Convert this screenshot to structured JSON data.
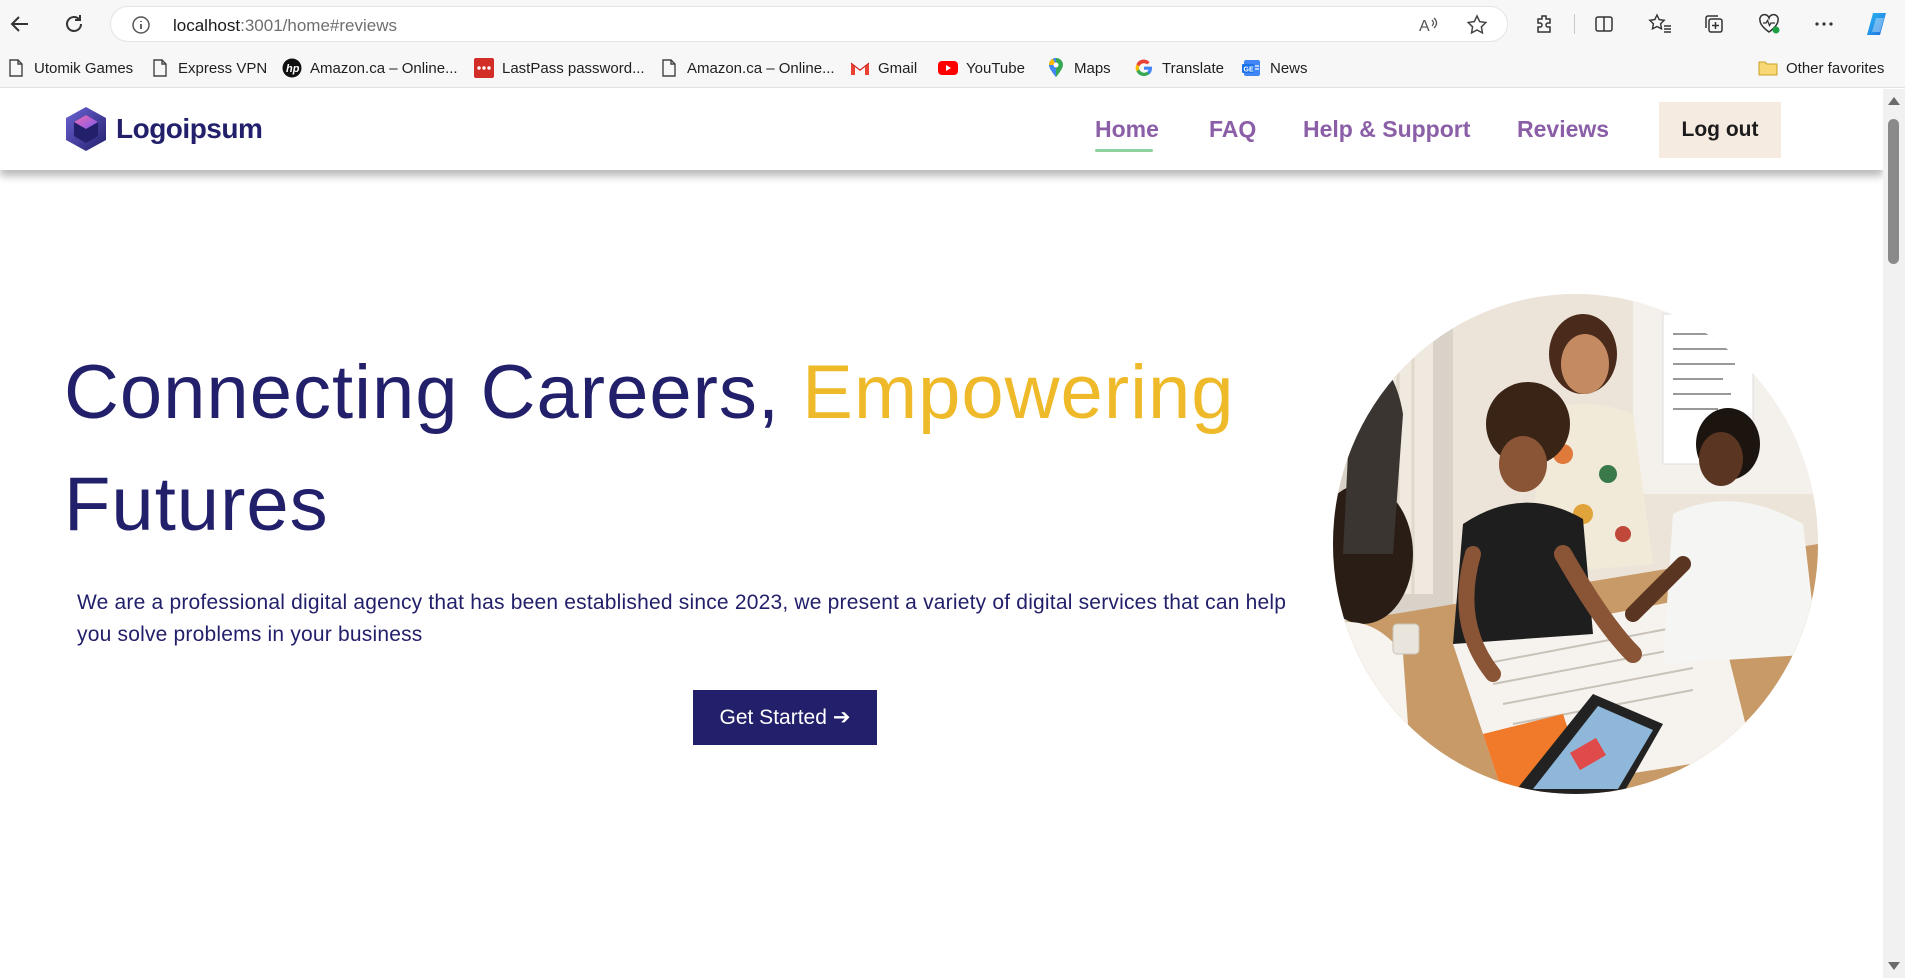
{
  "browser": {
    "url_host": "localhost",
    "url_path": ":3001/home#reviews",
    "bookmarks": [
      {
        "label": "Utomik Games",
        "icon": "page-icon"
      },
      {
        "label": "Express VPN",
        "icon": "page-icon"
      },
      {
        "label": "Amazon.ca – Online...",
        "icon": "hp-icon"
      },
      {
        "label": "LastPass password...",
        "icon": "lastpass-icon"
      },
      {
        "label": "Amazon.ca – Online...",
        "icon": "page-icon"
      },
      {
        "label": "Gmail",
        "icon": "gmail-icon"
      },
      {
        "label": "YouTube",
        "icon": "youtube-icon"
      },
      {
        "label": "Maps",
        "icon": "maps-icon"
      },
      {
        "label": "Translate",
        "icon": "google-icon"
      },
      {
        "label": "News",
        "icon": "news-icon"
      }
    ],
    "other_favorites": "Other favorites"
  },
  "header": {
    "logo_text": "Logoipsum",
    "nav": [
      {
        "label": "Home",
        "active": true
      },
      {
        "label": "FAQ",
        "active": false
      },
      {
        "label": "Help & Support",
        "active": false
      },
      {
        "label": "Reviews",
        "active": false
      }
    ],
    "logout_label": "Log out"
  },
  "hero": {
    "title_part1": "Connecting Careers, ",
    "title_accent": "Empowering",
    "title_part2": "Futures",
    "description": "We are a professional digital agency that has been established since 2023, we present a variety of digital services that can help you solve problems in your business",
    "cta_label": "Get Started",
    "cta_arrow": "➔"
  },
  "colors": {
    "brand_navy": "#23206b",
    "accent_gold": "#efba2a",
    "nav_purple": "#8b5ea8",
    "nav_underline": "#8fd19e",
    "logout_bg": "#f6ebe0"
  }
}
